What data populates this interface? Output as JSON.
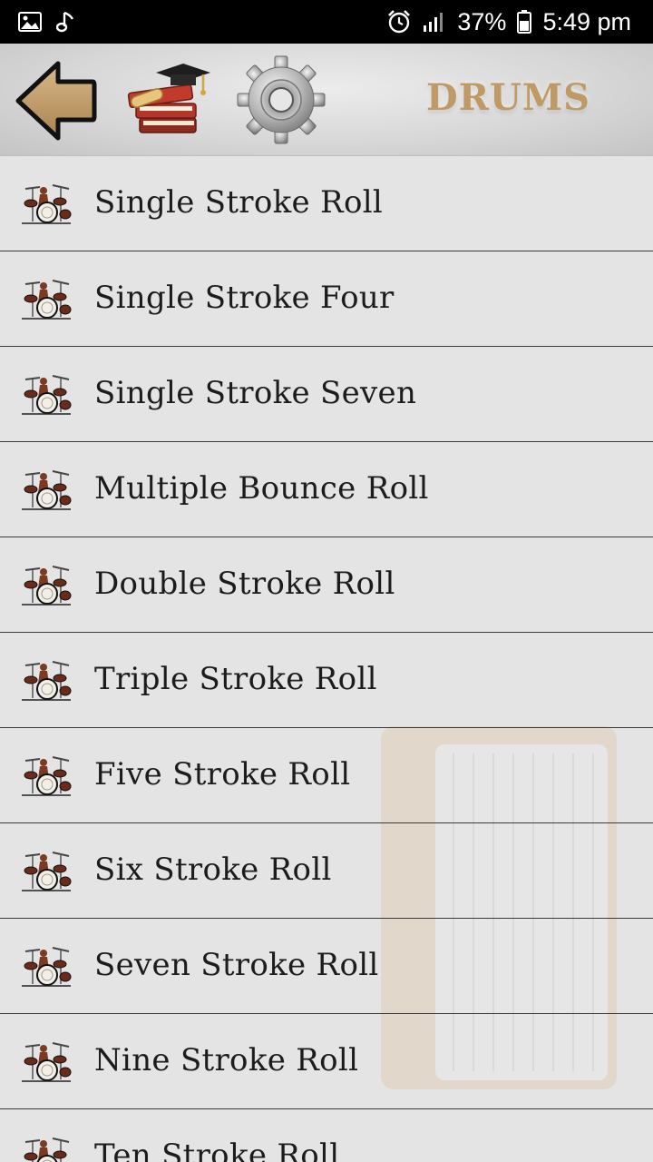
{
  "status_bar": {
    "battery": "37%",
    "time": "5:49 pm",
    "icons": [
      "image-icon",
      "music-note-icon",
      "alarm-icon",
      "signal-icon",
      "battery-icon"
    ]
  },
  "toolbar": {
    "title": "DRUMS",
    "buttons": [
      "back-arrow-icon",
      "books-graduation-icon",
      "gear-icon"
    ],
    "title_color": "#c09a66"
  },
  "list": {
    "items": [
      {
        "label": "Single Stroke Roll"
      },
      {
        "label": "Single Stroke Four"
      },
      {
        "label": "Single Stroke Seven"
      },
      {
        "label": "Multiple Bounce Roll"
      },
      {
        "label": "Double Stroke Roll"
      },
      {
        "label": "Triple Stroke Roll"
      },
      {
        "label": "Five Stroke Roll"
      },
      {
        "label": "Six Stroke Roll"
      },
      {
        "label": "Seven Stroke Roll"
      },
      {
        "label": "Nine Stroke Roll"
      },
      {
        "label": "Ten Stroke Roll"
      }
    ],
    "item_icon": "drum-kit-icon"
  }
}
